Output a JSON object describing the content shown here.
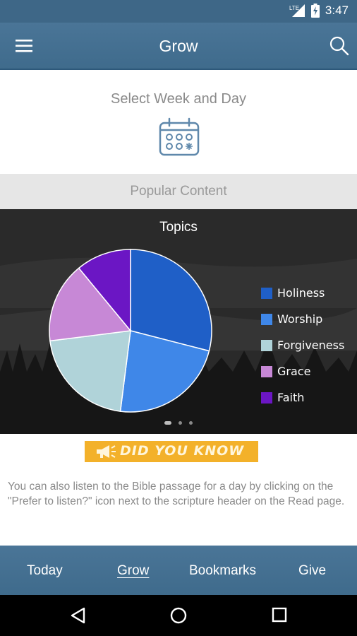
{
  "status_bar": {
    "network": "LTE",
    "time": "3:47",
    "icons": [
      "lte-signal-icon",
      "battery-charging-icon"
    ]
  },
  "app_bar": {
    "title": "Grow",
    "icons": [
      "menu-icon",
      "search-icon"
    ]
  },
  "select_week": {
    "label": "Select Week and Day",
    "icon": "calendar-icon"
  },
  "popular": {
    "label": "Popular Content"
  },
  "chart_data": {
    "type": "pie",
    "title": "Topics",
    "categories": [
      "Holiness",
      "Worship",
      "Forgiveness",
      "Grace",
      "Faith"
    ],
    "values": [
      29,
      23,
      21,
      16,
      11
    ],
    "colors": [
      "#1f5fc7",
      "#3f87e8",
      "#b0d3d9",
      "#c788d6",
      "#6b16c4"
    ],
    "legend_position": "right"
  },
  "carousel": {
    "pages": 3,
    "active_page": 1
  },
  "did_you_know": {
    "title": "DID YOU KNOW",
    "icon": "megaphone-icon",
    "body": "You can also listen to the Bible passage for a day by clicking on the \"Prefer to listen?\" icon next to the scripture header on the Read page."
  },
  "bottom_nav": {
    "items": [
      {
        "label": "Today"
      },
      {
        "label": "Grow"
      },
      {
        "label": "Bookmarks"
      },
      {
        "label": "Give"
      }
    ],
    "active": "Grow"
  },
  "system_nav": {
    "icons": [
      "back-icon",
      "home-icon",
      "recents-icon"
    ]
  },
  "colors": {
    "primary": "#3f6b8c",
    "accent": "#f3b12a",
    "muted_text": "#8a8a8a"
  }
}
